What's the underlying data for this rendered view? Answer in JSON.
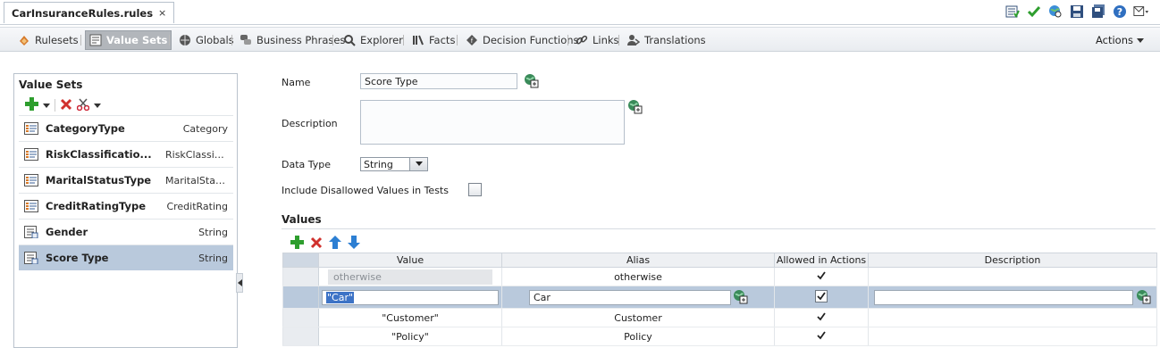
{
  "file_tab": {
    "title": "CarInsuranceRules.rules",
    "close": "×"
  },
  "nav": {
    "tabs": [
      {
        "label": "Rulesets",
        "icon": "rulesets-icon"
      },
      {
        "label": "Value Sets",
        "icon": "value-sets-icon",
        "active": true
      },
      {
        "label": "Globals",
        "icon": "globe-icon"
      },
      {
        "label": "Business Phrases",
        "icon": "business-phrases-icon"
      },
      {
        "label": "Explorer",
        "icon": "search-icon"
      },
      {
        "label": "Facts",
        "icon": "facts-icon"
      },
      {
        "label": "Decision Functions",
        "icon": "decision-function-icon"
      },
      {
        "label": "Links",
        "icon": "link-icon"
      },
      {
        "label": "Translations",
        "icon": "translations-icon"
      }
    ],
    "actions_label": "Actions"
  },
  "value_sets": {
    "title": "Value Sets",
    "items": [
      {
        "name": "CategoryType",
        "type": "Category",
        "icon": "enum-icon"
      },
      {
        "name": "RiskClassificatio...",
        "type": "RiskClassifi...",
        "icon": "enum-icon"
      },
      {
        "name": "MaritalStatusType",
        "type": "MaritalStatus",
        "icon": "enum-icon"
      },
      {
        "name": "CreditRatingType",
        "type": "CreditRating",
        "icon": "enum-icon"
      },
      {
        "name": "Gender",
        "type": "String",
        "icon": "list-icon"
      },
      {
        "name": "Score Type",
        "type": "String",
        "icon": "list-icon",
        "selected": true
      }
    ]
  },
  "form": {
    "name_label": "Name",
    "name_value": "Score Type",
    "description_label": "Description",
    "description_value": "",
    "data_type_label": "Data Type",
    "data_type_value": "String",
    "include_disallowed_label": "Include Disallowed Values in Tests",
    "include_disallowed_checked": false
  },
  "values": {
    "heading": "Values",
    "columns": [
      "Value",
      "Alias",
      "Allowed in Actions",
      "Description"
    ],
    "rows": [
      {
        "value": "otherwise",
        "alias": "otherwise",
        "allowed": true,
        "description": ""
      },
      {
        "value": "\"Car\"",
        "alias": "Car",
        "allowed": true,
        "description": "",
        "editing": true
      },
      {
        "value": "\"Customer\"",
        "alias": "Customer",
        "allowed": true,
        "description": ""
      },
      {
        "value": "\"Policy\"",
        "alias": "Policy",
        "allowed": true,
        "description": ""
      }
    ]
  },
  "colors": {
    "selected_row": "#b9c9dc",
    "active_tab": "#b2b6bb",
    "add_green": "#2e9e2e",
    "delete_red": "#d0312d",
    "arrow_blue": "#2d7fd3"
  }
}
